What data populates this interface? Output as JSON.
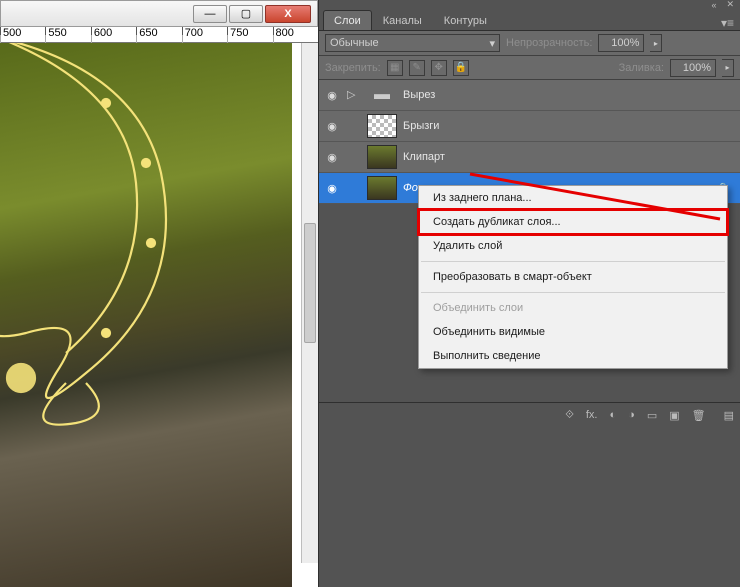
{
  "window_controls": {
    "min": "—",
    "max": "▢",
    "close": "X"
  },
  "ruler_ticks": [
    "500",
    "550",
    "600",
    "650",
    "700",
    "750",
    "800"
  ],
  "panel": {
    "top_icons": {
      "collapse": "«",
      "close": "✕"
    },
    "tabs": [
      {
        "label": "Слои",
        "active": true
      },
      {
        "label": "Каналы",
        "active": false
      },
      {
        "label": "Контуры",
        "active": false
      }
    ],
    "menu_icon": "▾≡",
    "blend_mode": "Обычные",
    "opacity_label": "Непрозрачность:",
    "opacity_value": "100%",
    "lock_label": "Закрепить:",
    "lock_icons": [
      "▦",
      "✎",
      "✥",
      "🔒"
    ],
    "fill_label": "Заливка:",
    "fill_value": "100%"
  },
  "layers": [
    {
      "name": "Вырез",
      "kind": "group",
      "selected": false
    },
    {
      "name": "Брызги",
      "kind": "checker",
      "selected": false
    },
    {
      "name": "Клипарт",
      "kind": "dark",
      "selected": false
    },
    {
      "name": "Фон",
      "kind": "dark",
      "selected": true
    }
  ],
  "bottom_icons": {
    "link": "⟐",
    "fx": "fx.",
    "mask": "◐",
    "adjust": "◑",
    "folder": "▭",
    "new": "▣",
    "trash": "🗑",
    "menu": "▤"
  },
  "context_menu": {
    "items": [
      {
        "label": "Из заднего плана...",
        "disabled": false,
        "hl": false
      },
      {
        "label": "Создать дубликат слоя...",
        "disabled": false,
        "hl": true
      },
      {
        "label": "Удалить слой",
        "disabled": false,
        "hl": false
      },
      {
        "sep": true
      },
      {
        "label": "Преобразовать в смарт-объект",
        "disabled": false,
        "hl": false
      },
      {
        "sep": true
      },
      {
        "label": "Объединить слои",
        "disabled": true,
        "hl": false
      },
      {
        "label": "Объединить видимые",
        "disabled": false,
        "hl": false
      },
      {
        "label": "Выполнить сведение",
        "disabled": false,
        "hl": false
      }
    ]
  }
}
